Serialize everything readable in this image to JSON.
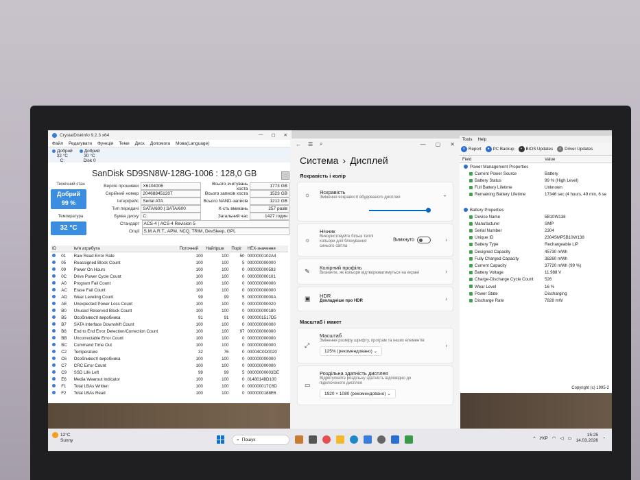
{
  "crystaldiskinfo": {
    "title": "CrystalDiskInfo 9.2.3 x64",
    "menu": [
      "Файл",
      "Редагувати",
      "Функція",
      "Теми",
      "Диск",
      "Допомога",
      "Мова(Language)"
    ],
    "disk_tab": {
      "status": "Добрий",
      "temp": "32 °C",
      "letter": "C:"
    },
    "disk_tab2": {
      "status": "Добрий",
      "temp": "30 °C",
      "letter": "Disk 0"
    },
    "model": "SanDisk SD9SN8W-128G-1006 : 128,0 GB",
    "health_label": "Технічний стан",
    "health_status": "Добрий",
    "health_pct": "99 %",
    "temp_label": "Температура",
    "temp_value": "32 °C",
    "firmware_label": "Версія прошивки",
    "firmware": "X6104006",
    "serial_label": "Серійний номер",
    "serial": "204688451207",
    "interface_label": "Інтерфейс",
    "interface": "Serial ATA",
    "transfer_label": "Тип передачі",
    "transfer": "SATA/600 | SATA/600",
    "drive_letter_label": "Буква диску",
    "drive_letter": "C:",
    "host_reads_label": "Всього зчитувань хоста",
    "host_reads": "1773 GB",
    "host_writes_label": "Всього записів хоста",
    "host_writes": "1523 GB",
    "nand_writes_label": "Всього NAND-записів",
    "nand_writes": "1212 GB",
    "power_count_label": "К-сть вмикань",
    "power_count": "257 разів",
    "power_hours_label": "Загальний час",
    "power_hours": "1427 годин",
    "standard_label": "Стандарт",
    "standard": "ACS-4 | ACS-4 Revision 5",
    "features_label": "Опції",
    "features": "S.M.A.R.T., APM, NCQ, TRIM, DevSleep, GPL",
    "columns": [
      "ID",
      "Ім'я атрибута",
      "Поточний",
      "Найгірше",
      "Поріг",
      "HEX-значення"
    ],
    "rows": [
      [
        "01",
        "Raw Read Error Rate",
        "100",
        "100",
        "50",
        "0000000102A4"
      ],
      [
        "05",
        "Reassigned Block Count",
        "100",
        "100",
        "5",
        "000000000000"
      ],
      [
        "09",
        "Power On Hours",
        "100",
        "100",
        "0",
        "000000000593"
      ],
      [
        "0C",
        "Drive Power Cycle Count",
        "100",
        "100",
        "0",
        "000000000101"
      ],
      [
        "A0",
        "Program Fail Count",
        "100",
        "100",
        "0",
        "000000000000"
      ],
      [
        "AC",
        "Erase Fail Count",
        "100",
        "100",
        "0",
        "000000000000"
      ],
      [
        "AD",
        "Wear Leveling Count",
        "99",
        "99",
        "5",
        "00000000000A"
      ],
      [
        "AE",
        "Unexpected Power Loss Count",
        "100",
        "100",
        "0",
        "000000000020"
      ],
      [
        "B0",
        "Unused Reserved Block Count",
        "100",
        "100",
        "0",
        "000000000180"
      ],
      [
        "B5",
        "Особливості виробника",
        "91",
        "91",
        "0",
        "0000001517D5"
      ],
      [
        "B7",
        "SATA Interface Downshift Count",
        "100",
        "100",
        "0",
        "000000000000"
      ],
      [
        "B8",
        "End to End Error Detection/Correction Count",
        "100",
        "100",
        "97",
        "000000000000"
      ],
      [
        "BB",
        "Uncorrectable Error Count",
        "100",
        "100",
        "0",
        "000000000000"
      ],
      [
        "BC",
        "Command Time Out",
        "100",
        "100",
        "0",
        "000000000000"
      ],
      [
        "C2",
        "Temperature",
        "32",
        "76",
        "0",
        "00004C0D0020"
      ],
      [
        "C6",
        "Особливості виробника",
        "100",
        "100",
        "0",
        "000000000000"
      ],
      [
        "C7",
        "CRC Error Count",
        "100",
        "100",
        "0",
        "000000000000"
      ],
      [
        "C9",
        "SSD Life Left",
        "99",
        "99",
        "5",
        "00000000003DE"
      ],
      [
        "E6",
        "Media Wearout Indicator",
        "100",
        "100",
        "0",
        "01480148D100"
      ],
      [
        "F1",
        "Total LBAs Written",
        "100",
        "100",
        "0",
        "000000017C6D"
      ],
      [
        "F2",
        "Total LBAs Read",
        "100",
        "100",
        "0",
        "0000000188E6"
      ]
    ]
  },
  "settings": {
    "breadcrumb_parent": "Система",
    "breadcrumb_current": "Дисплей",
    "section1": "Яскравість і колір",
    "brightness_title": "Яскравість",
    "brightness_desc": "Змінення яскравості вбудованого дисплея",
    "brightness_level": 0.95,
    "night_title": "Нічник",
    "night_desc": "Використовуйте більш теплі кольори для блокування синього світла",
    "night_state": "Вимкнуто",
    "color_title": "Колірний профіль",
    "color_desc": "Визначте, як кольори відтворюватимуться на екрані",
    "hdr_title": "HDR",
    "hdr_link": "Докладніше про HDR",
    "section2": "Масштаб і макет",
    "scale_title": "Масштаб",
    "scale_desc": "Змінення розміру шрифту, програм та інших елементів",
    "scale_value": "125% (рекомендовано)",
    "res_title": "Роздільна здатність дисплея",
    "res_desc": "Відрегулюйте роздільну здатність відповідно до підключеного дисплея",
    "res_value": "1920 × 1080 (рекомендовано)"
  },
  "hwinfo": {
    "menus": [
      "Tools",
      "Help"
    ],
    "toolbar": [
      "Report",
      "PC Backup",
      "BIOS Updates",
      "Driver Updates"
    ],
    "col_field": "Field",
    "col_value": "Value",
    "group1": "Power Management Properties",
    "pm": [
      [
        "Current Power Source",
        "Battery"
      ],
      [
        "Battery Status",
        "99 % (High Level)"
      ],
      [
        "Full Battery Lifetime",
        "Unknown"
      ],
      [
        "Remaining Battery Lifetime",
        "17346 sec (4 hours, 49 min, 6 se"
      ]
    ],
    "group2": "Battery Properties",
    "bp": [
      [
        "Device Name",
        "5B10W138"
      ],
      [
        "Manufacturer",
        "SMP"
      ],
      [
        "Serial Number",
        "2304"
      ],
      [
        "Unique ID",
        "2304SMP5B10W138"
      ],
      [
        "Battery Type",
        "Rechargeable LiP"
      ],
      [
        "Designed Capacity",
        "45730 mWh"
      ],
      [
        "Fully Charged Capacity",
        "38260 mWh"
      ],
      [
        "Current Capacity",
        "37720 mWh  (99 %)"
      ],
      [
        "Battery Voltage",
        "11.988 V"
      ],
      [
        "Charge-Discharge Cycle Count",
        "526"
      ],
      [
        "Wear Level",
        "16 %"
      ],
      [
        "Power State",
        "Discharging"
      ],
      [
        "Discharge Rate",
        "7828 mW"
      ]
    ],
    "copyright": "Copyright (c) 1995-2"
  },
  "taskbar": {
    "weather_temp": "12°C",
    "weather_desc": "Sunny",
    "search_placeholder": "Пошук",
    "lang": "УКР",
    "time": "15:25",
    "date": "14.03.2026"
  }
}
